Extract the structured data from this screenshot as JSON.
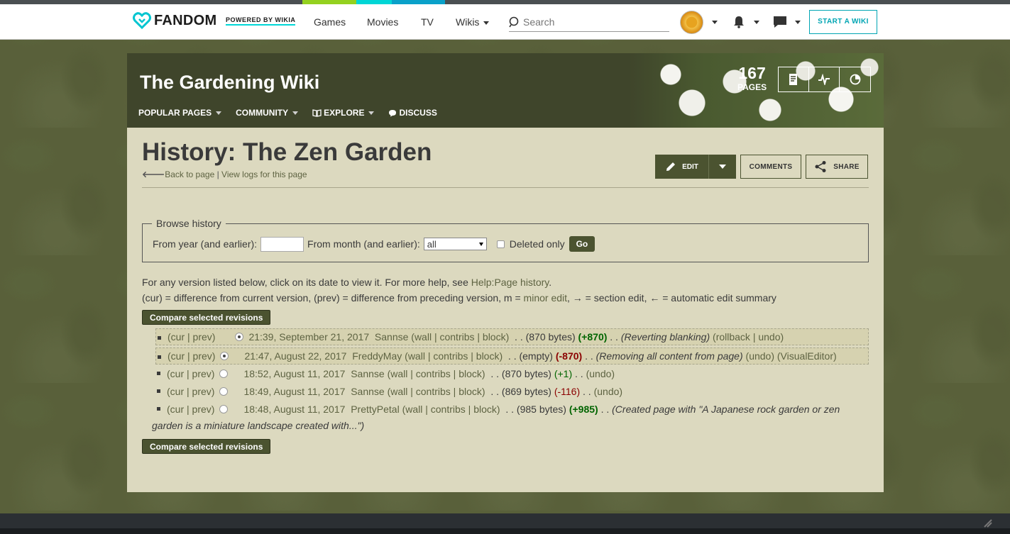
{
  "global_nav": {
    "brand": "FANDOM",
    "powered_by": "POWERED BY WIKIA",
    "links": [
      "Games",
      "Movies",
      "TV",
      "Wikis"
    ],
    "search_placeholder": "Search",
    "start_wiki": "START A WIKI"
  },
  "wiki_header": {
    "title": "The Gardening Wiki",
    "tabs": [
      "POPULAR PAGES",
      "COMMUNITY",
      "EXPLORE",
      "DISCUSS"
    ],
    "page_count": "167",
    "page_count_label": "PAGES"
  },
  "page": {
    "title": "History: The Zen Garden",
    "back_link": "Back to page",
    "sep": " | ",
    "logs_link": "View logs for this page",
    "edit_label": "EDIT",
    "comments_label": "COMMENTS",
    "share_label": "SHARE"
  },
  "browse": {
    "legend": "Browse history",
    "year_label": "From year (and earlier):",
    "year_value": "",
    "month_label": "From month (and earlier):",
    "month_value": "all",
    "deleted_label": "Deleted only",
    "go_label": "Go"
  },
  "help": {
    "line1_prefix": "For any version listed below, click on its date to view it. For more help, see ",
    "line1_link": "Help:Page history",
    "line1_suffix": ".",
    "line2_a": "(cur) = difference from current version, (prev) = difference from preceding version, m = ",
    "line2_minor": "minor edit",
    "line2_b": ", → = section edit, ← = automatic edit summary"
  },
  "compare_label": "Compare selected revisions",
  "revisions": [
    {
      "curprev": "(cur | prev)",
      "date": "21:39, September 21, 2017",
      "user": "Sannse",
      "tools": "(wall | contribs | block)",
      "size": ". . (870 bytes)",
      "diff": "(+870)",
      "summary": "(Reverting blanking)",
      "actions": "(rollback | undo)"
    },
    {
      "curprev": "(cur | prev)",
      "date": "21:47, August 22, 2017",
      "user": "FreddyMay",
      "tools": "(wall | contribs | block)",
      "size": ". . (empty)",
      "diff": "(-870)",
      "summary": "(Removing all content from page)",
      "actions": "(undo) (VisualEditor)"
    },
    {
      "curprev": "(cur | prev)",
      "date": "18:52, August 11, 2017",
      "user": "Sannse",
      "tools": "(wall | contribs | block)",
      "size": ". . (870 bytes)",
      "diff": "(+1)",
      "summary": "",
      "actions": "(undo)"
    },
    {
      "curprev": "(cur | prev)",
      "date": "18:49, August 11, 2017",
      "user": "Sannse",
      "tools": "(wall | contribs | block)",
      "size": ". . (869 bytes)",
      "diff": "(-116)",
      "summary": "",
      "actions": "(undo)"
    },
    {
      "curprev": "(cur | prev)",
      "date": "18:48, August 11, 2017",
      "user": "PrettyPetal",
      "tools": "(wall | contribs | block)",
      "size": ". . (985 bytes)",
      "diff": "(+985)",
      "summary_line1": "(Created page with \"A Japanese rock garden or zen",
      "summary_line2": "garden is a miniature landscape created with...\")"
    }
  ],
  "colors": {
    "header_bg": "#3f452b",
    "content_bg": "#dcd9bf",
    "button_bg": "#4b5330",
    "accent": "#00a5b3"
  }
}
